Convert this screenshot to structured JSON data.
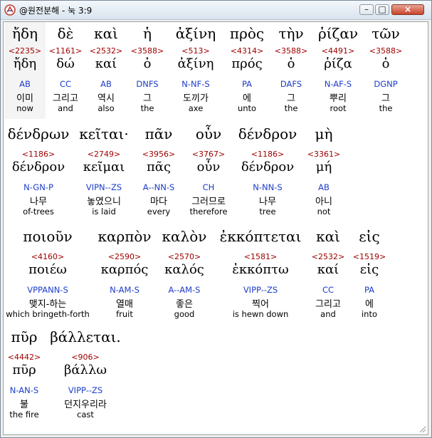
{
  "window": {
    "title": "@원전분해 - 눅 3:9",
    "controls": {
      "minimize": "–",
      "maximize": "□",
      "close": "×"
    }
  },
  "rows": [
    [
      {
        "greek": "ἤδη",
        "strong": "<2235>",
        "lemma": "ἤδη",
        "parse": "AB",
        "korean": "이미",
        "english": "now",
        "selected": true
      },
      {
        "greek": "δὲ",
        "strong": "<1161>",
        "lemma": "δώ",
        "parse": "CC",
        "korean": "그리고",
        "english": "and"
      },
      {
        "greek": "καὶ",
        "strong": "<2532>",
        "lemma": "καί",
        "parse": "AB",
        "korean": "역시",
        "english": "also"
      },
      {
        "greek": "ἡ",
        "strong": "<3588>",
        "lemma": "ὁ",
        "parse": "DNFS",
        "korean": "그",
        "english": "the"
      },
      {
        "greek": "ἀξίνη",
        "strong": "<513>",
        "lemma": "ἀξίνη",
        "parse": "N-NF-S",
        "korean": "도끼가",
        "english": "axe"
      },
      {
        "greek": "πρὸς",
        "strong": "<4314>",
        "lemma": "πρός",
        "parse": "PA",
        "korean": "에",
        "english": "unto"
      },
      {
        "greek": "τὴν",
        "strong": "<3588>",
        "lemma": "ὁ",
        "parse": "DAFS",
        "korean": "그",
        "english": "the"
      },
      {
        "greek": "ῥίζαν",
        "strong": "<4491>",
        "lemma": "ῥίζα",
        "parse": "N-AF-S",
        "korean": "뿌리",
        "english": "root"
      },
      {
        "greek": "τῶν",
        "strong": "<3588>",
        "lemma": "ὁ",
        "parse": "DGNP",
        "korean": "그",
        "english": "the"
      }
    ],
    [
      {
        "greek": "δένδρων",
        "strong": "<1186>",
        "lemma": "δένδρον",
        "parse": "N-GN-P",
        "korean": "나무",
        "english": "of-trees"
      },
      {
        "greek": "κεῖται·",
        "strong": "<2749>",
        "lemma": "κεῖμαι",
        "parse": "VIPN--ZS",
        "korean": "놓였으니",
        "english": "is laid"
      },
      {
        "greek": "πᾶν",
        "strong": "<3956>",
        "lemma": "πᾶς",
        "parse": "A--NN-S",
        "korean": "마다",
        "english": "every"
      },
      {
        "greek": "οὖν",
        "strong": "<3767>",
        "lemma": "οὖν",
        "parse": "CH",
        "korean": "그러므로",
        "english": "therefore"
      },
      {
        "greek": "δένδρον",
        "strong": "<1186>",
        "lemma": "δένδρον",
        "parse": "N-NN-S",
        "korean": "나무",
        "english": "tree"
      },
      {
        "greek": "μὴ",
        "strong": "<3361>",
        "lemma": "μή",
        "parse": "AB",
        "korean": "아니",
        "english": "not"
      }
    ],
    [
      {
        "greek": "ποιοῦν",
        "strong": "<4160>",
        "lemma": "ποιέω",
        "parse": "VPPANN-S",
        "korean": "맺지-하는",
        "english": "which bringeth-forth"
      },
      {
        "greek": "καρπὸν",
        "strong": "<2590>",
        "lemma": "καρπός",
        "parse": "N-AM-S",
        "korean": "열매",
        "english": "fruit"
      },
      {
        "greek": "καλὸν",
        "strong": "<2570>",
        "lemma": "καλός",
        "parse": "A--AM-S",
        "korean": "좋은",
        "english": "good"
      },
      {
        "greek": "ἐκκόπτεται",
        "strong": "<1581>",
        "lemma": "ἐκκόπτω",
        "parse": "VIPP--ZS",
        "korean": "찍어",
        "english": "is hewn down"
      },
      {
        "greek": "καὶ",
        "strong": "<2532>",
        "lemma": "καί",
        "parse": "CC",
        "korean": "그리고",
        "english": "and"
      },
      {
        "greek": "εἰς",
        "strong": "<1519>",
        "lemma": "εἰς",
        "parse": "PA",
        "korean": "에",
        "english": "into"
      }
    ],
    [
      {
        "greek": "πῦρ",
        "strong": "<4442>",
        "lemma": "πῦρ",
        "parse": "N-AN-S",
        "korean": "불",
        "english": "the fire"
      },
      {
        "greek": "βάλλεται.",
        "strong": "<906>",
        "lemma": "βάλλω",
        "parse": "VIPP--ZS",
        "korean": "던지우리라",
        "english": "cast"
      }
    ]
  ]
}
